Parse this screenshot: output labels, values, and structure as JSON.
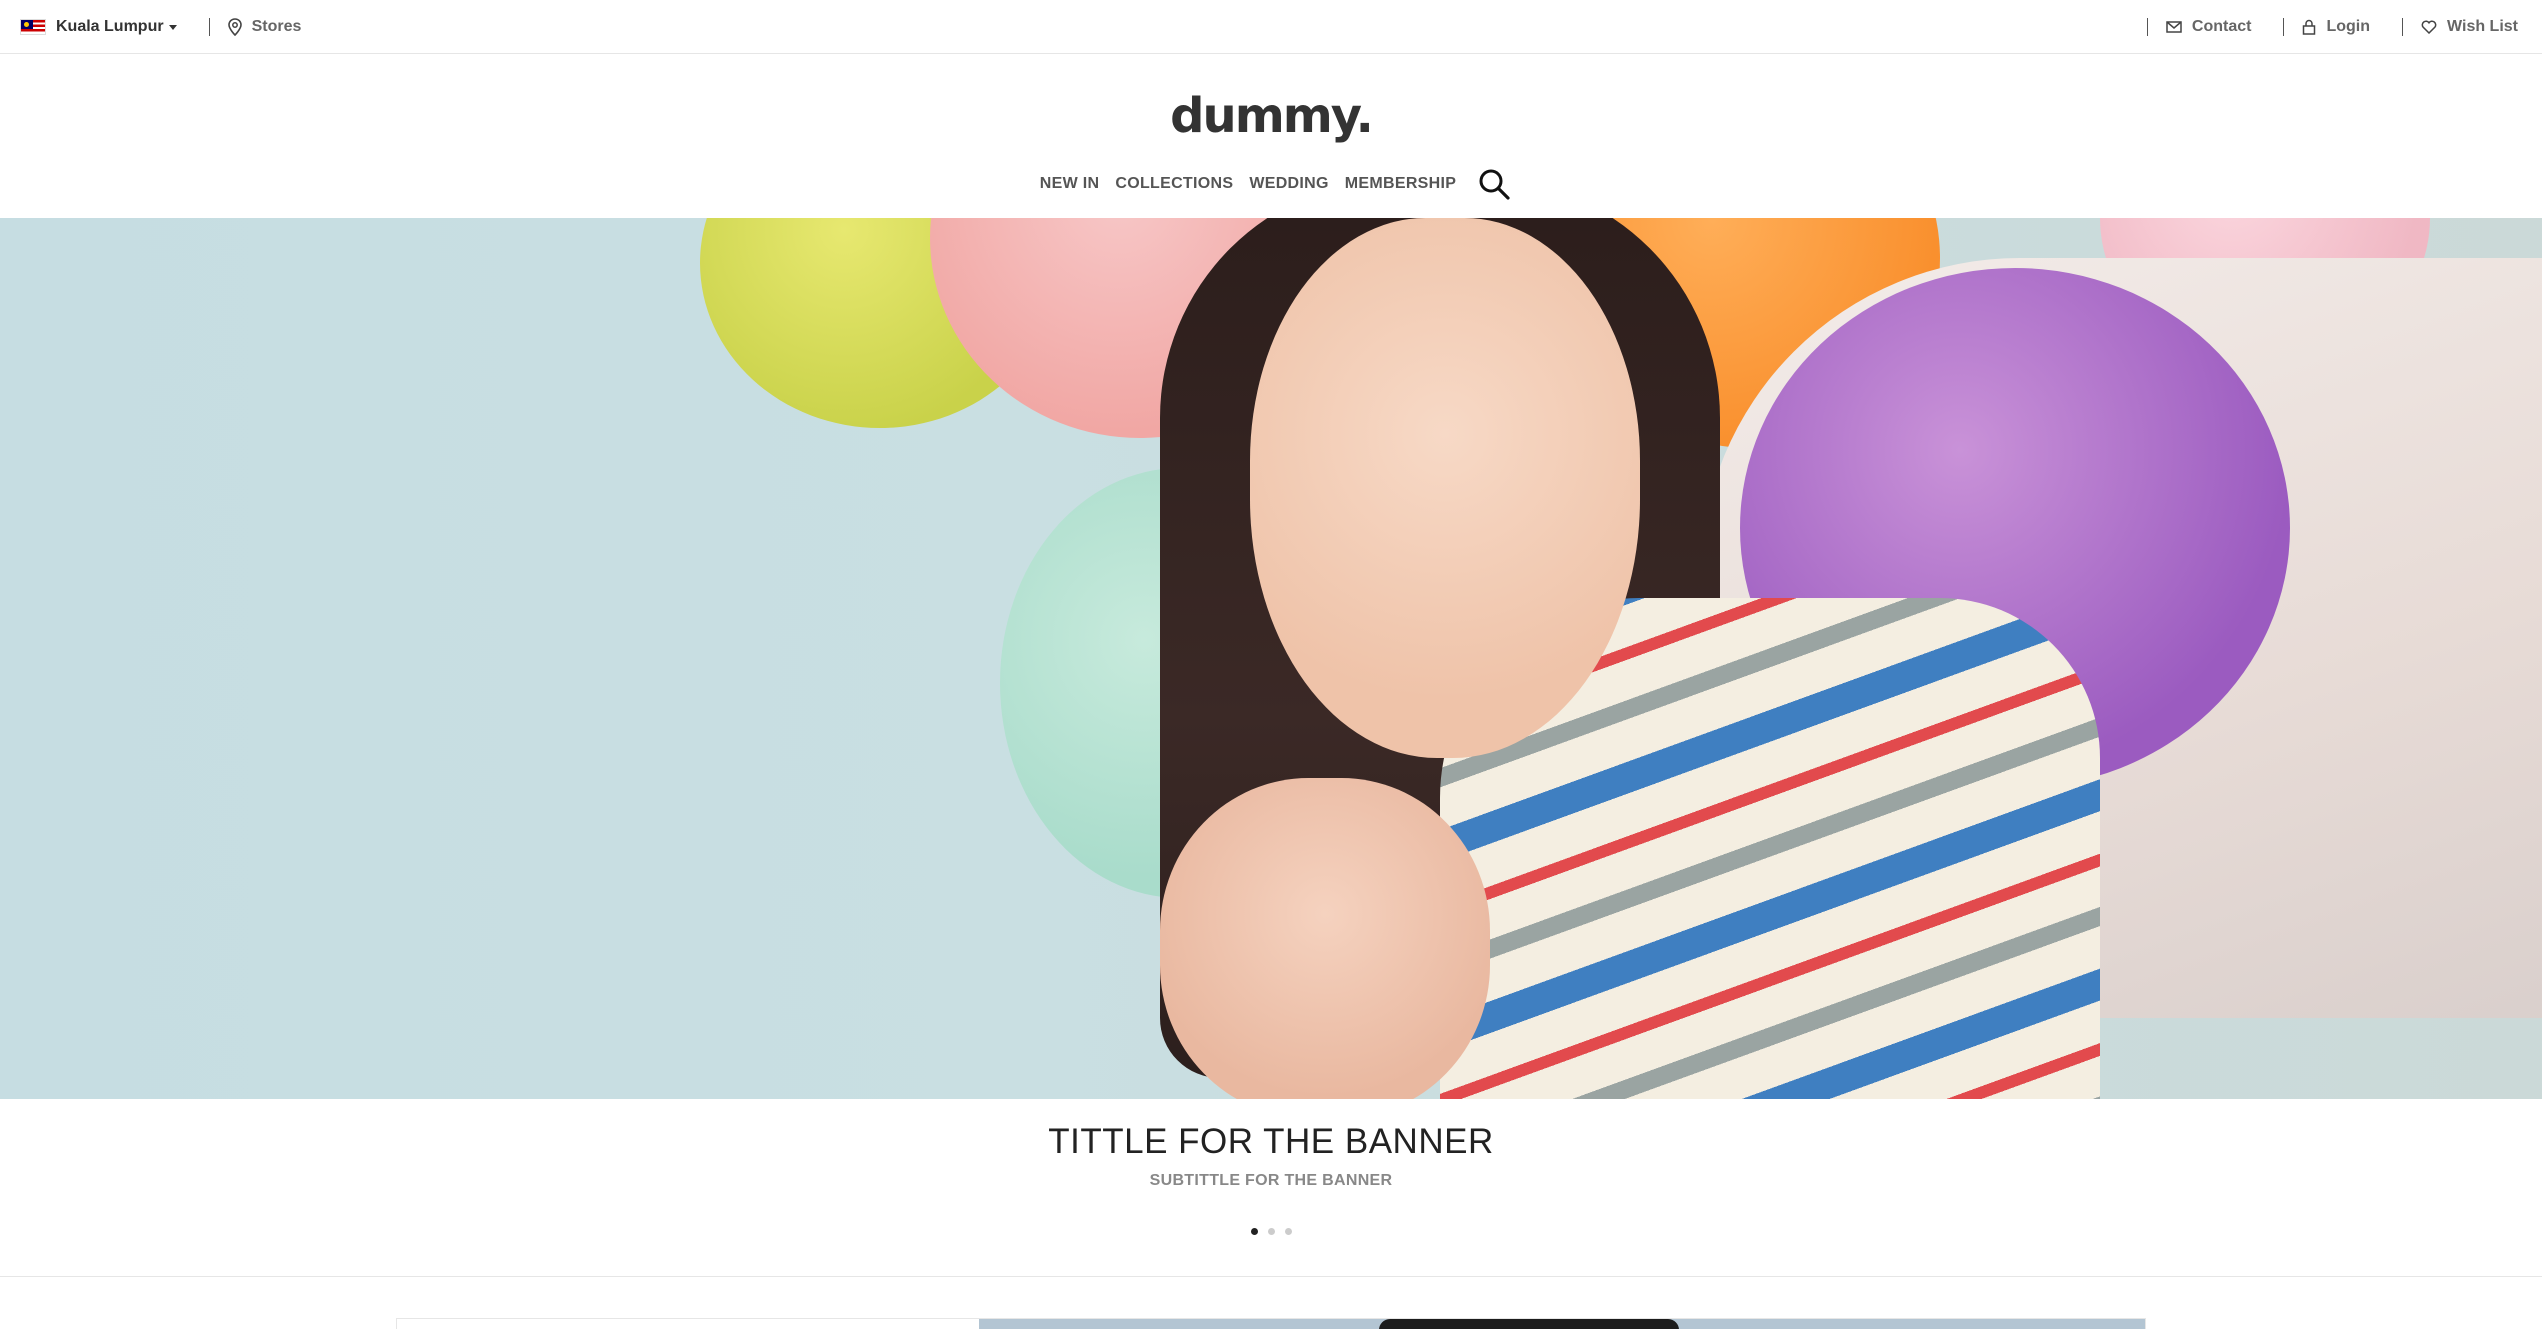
{
  "topbar": {
    "location": "Kuala Lumpur",
    "stores_label": "Stores",
    "contact_label": "Contact",
    "login_label": "Login",
    "wishlist_label": "Wish List"
  },
  "header": {
    "logo": "dummy.",
    "nav": [
      "NEW IN",
      "COLLECTIONS",
      "WEDDING",
      "MEMBERSHIP"
    ]
  },
  "banner": {
    "title": "TITTLE FOR THE BANNER",
    "subtitle": "SUBTITTLE FOR THE BANNER",
    "slides_total": 3,
    "active_slide": 1
  },
  "icons": [
    "malaysia-flag-icon",
    "chevron-down-icon",
    "map-pin-icon",
    "mail-icon",
    "lock-icon",
    "heart-icon",
    "search-icon"
  ],
  "colors": {
    "text": "#333333",
    "muted": "#888888",
    "border": "#e6e6e6",
    "dot_active": "#222222",
    "dot_inactive": "#cccccc"
  }
}
